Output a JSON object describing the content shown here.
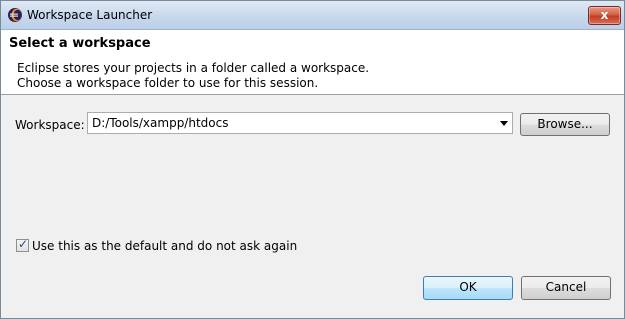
{
  "window": {
    "title": "Workspace Launcher",
    "close_label": "x"
  },
  "header": {
    "title": "Select a workspace",
    "desc_line1": "Eclipse stores your projects in a folder called a workspace.",
    "desc_line2": "Choose a workspace folder to use for this session."
  },
  "workspace": {
    "label": "Workspace:",
    "value": "D:/Tools/xampp/htdocs",
    "browse_label": "Browse..."
  },
  "default_checkbox": {
    "checked": true,
    "label": "Use this as the default and do not ask again"
  },
  "buttons": {
    "ok": "OK",
    "cancel": "Cancel"
  },
  "colors": {
    "title_bar": "#c6d7ec",
    "close_button": "#c13a1d",
    "accent": "#3c7fb1"
  },
  "icons": {
    "app": "eclipse-icon",
    "dropdown": "chevron-down-icon",
    "check": "checkmark-icon"
  }
}
